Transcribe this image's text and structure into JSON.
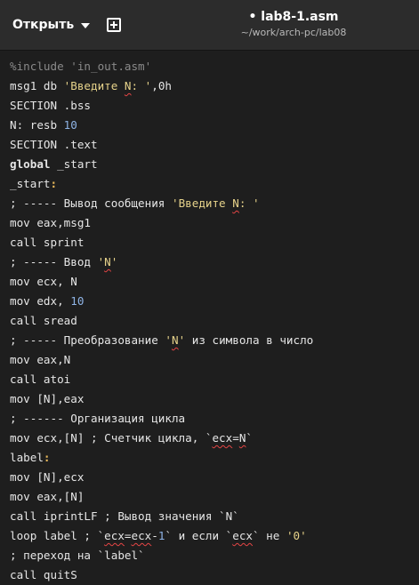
{
  "header": {
    "open_label": "Открыть",
    "title": "• lab8-1.asm",
    "subtitle": "~/work/arch-pc/lab08"
  },
  "code": {
    "l1": "%include 'in_out.asm'",
    "l2a": "msg1 db ",
    "l2b": "'Введите ",
    "l2c": "N",
    "l2d": ": '",
    "l2e": ",0h",
    "l3": "SECTION .bss",
    "l4a": "N",
    "l4b": ": resb ",
    "l4c": "10",
    "l5": "SECTION .text",
    "l6a": "global",
    "l6b": " _start",
    "l7a": "_start",
    "l7b": ":",
    "l8a": "; ----- Вывод сообщения ",
    "l8b": "'Введите ",
    "l8c": "N",
    "l8d": ": '",
    "l9": "mov eax,msg1",
    "l10": "call sprint",
    "l11a": "; ----- Ввод ",
    "l11b": "'",
    "l11c": "N",
    "l11d": "'",
    "l12": "mov ecx, N",
    "l13a": "mov edx, ",
    "l13b": "10",
    "l14": "call sread",
    "l15a": "; ----- Преобразование ",
    "l15b": "'",
    "l15c": "N",
    "l15d": "'",
    "l15e": " из символа в число",
    "l16": "mov eax,N",
    "l17": "call atoi",
    "l18": "mov [N],eax",
    "l19": "; ------ Организация цикла",
    "l20a": "mov ecx,[N] ; Счетчик цикла, `",
    "l20b": "ecx",
    "l20c": "=",
    "l20d": "N",
    "l20e": "`",
    "l21a": "label",
    "l21b": ":",
    "l22": "mov [N],ecx",
    "l23": "mov eax,[N]",
    "l24": "call iprintLF ; Вывод значения `N`",
    "l25a": "loop label ; `",
    "l25b": "ecx",
    "l25c": "=",
    "l25d": "ecx",
    "l25e": "-",
    "l25f": "1",
    "l25g": "` и если `",
    "l25h": "ecx",
    "l25i": "` не ",
    "l25j": "'0'",
    "l26": "; переход на `label`",
    "l27": "call quitS"
  }
}
